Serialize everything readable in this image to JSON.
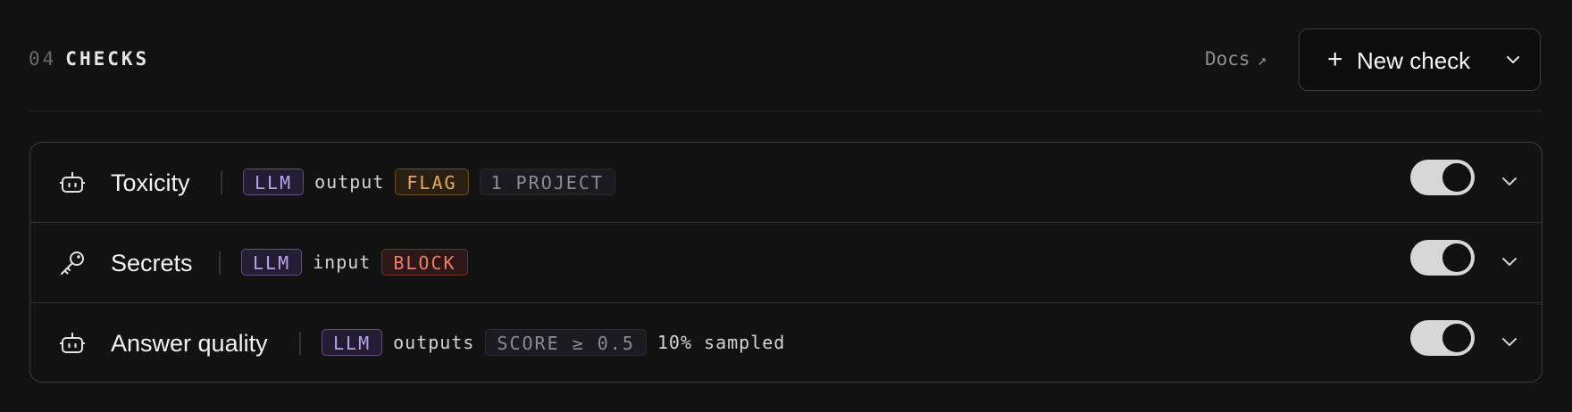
{
  "header": {
    "count": "04",
    "title": "CHECKS",
    "docs_label": "Docs",
    "docs_arrow": "↗",
    "new_check_plus": "+",
    "new_check_label": "New check"
  },
  "checks": [
    {
      "name": "Toxicity",
      "icon": "robot-icon",
      "model_badge": "LLM",
      "target": "output",
      "action_badge": "FLAG",
      "scope_badge": "1 PROJECT",
      "enabled": true
    },
    {
      "name": "Secrets",
      "icon": "key-icon",
      "model_badge": "LLM",
      "target": "input",
      "action_badge": "BLOCK",
      "enabled": true
    },
    {
      "name": "Answer quality",
      "icon": "robot-icon",
      "model_badge": "LLM",
      "target": "outputs",
      "action_badge": "SCORE ≥ 0.5",
      "sampling": "10% sampled",
      "enabled": true
    }
  ],
  "colors": {
    "background": "#121212",
    "llm_badge": "#b8a2ee",
    "flag_badge": "#e5a85c",
    "block_badge": "#f07a6a",
    "toggle_on": "#d7d7d7"
  }
}
